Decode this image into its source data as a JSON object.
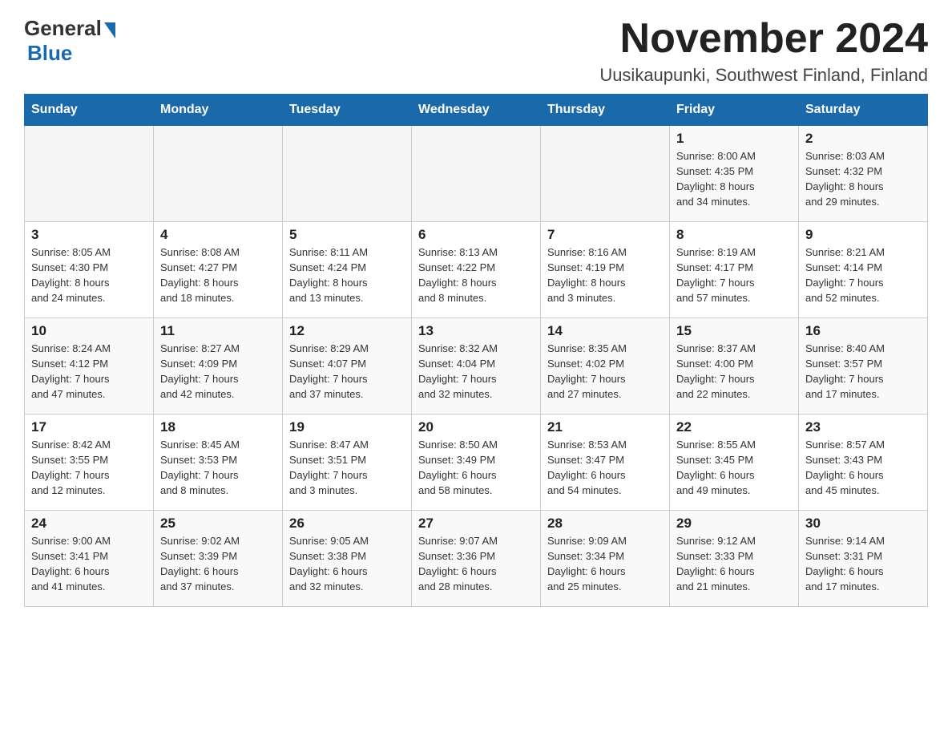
{
  "header": {
    "logo_general": "General",
    "logo_blue": "Blue",
    "month_title": "November 2024",
    "location": "Uusikaupunki, Southwest Finland, Finland"
  },
  "weekdays": [
    "Sunday",
    "Monday",
    "Tuesday",
    "Wednesday",
    "Thursday",
    "Friday",
    "Saturday"
  ],
  "weeks": [
    [
      {
        "day": "",
        "info": ""
      },
      {
        "day": "",
        "info": ""
      },
      {
        "day": "",
        "info": ""
      },
      {
        "day": "",
        "info": ""
      },
      {
        "day": "",
        "info": ""
      },
      {
        "day": "1",
        "info": "Sunrise: 8:00 AM\nSunset: 4:35 PM\nDaylight: 8 hours\nand 34 minutes."
      },
      {
        "day": "2",
        "info": "Sunrise: 8:03 AM\nSunset: 4:32 PM\nDaylight: 8 hours\nand 29 minutes."
      }
    ],
    [
      {
        "day": "3",
        "info": "Sunrise: 8:05 AM\nSunset: 4:30 PM\nDaylight: 8 hours\nand 24 minutes."
      },
      {
        "day": "4",
        "info": "Sunrise: 8:08 AM\nSunset: 4:27 PM\nDaylight: 8 hours\nand 18 minutes."
      },
      {
        "day": "5",
        "info": "Sunrise: 8:11 AM\nSunset: 4:24 PM\nDaylight: 8 hours\nand 13 minutes."
      },
      {
        "day": "6",
        "info": "Sunrise: 8:13 AM\nSunset: 4:22 PM\nDaylight: 8 hours\nand 8 minutes."
      },
      {
        "day": "7",
        "info": "Sunrise: 8:16 AM\nSunset: 4:19 PM\nDaylight: 8 hours\nand 3 minutes."
      },
      {
        "day": "8",
        "info": "Sunrise: 8:19 AM\nSunset: 4:17 PM\nDaylight: 7 hours\nand 57 minutes."
      },
      {
        "day": "9",
        "info": "Sunrise: 8:21 AM\nSunset: 4:14 PM\nDaylight: 7 hours\nand 52 minutes."
      }
    ],
    [
      {
        "day": "10",
        "info": "Sunrise: 8:24 AM\nSunset: 4:12 PM\nDaylight: 7 hours\nand 47 minutes."
      },
      {
        "day": "11",
        "info": "Sunrise: 8:27 AM\nSunset: 4:09 PM\nDaylight: 7 hours\nand 42 minutes."
      },
      {
        "day": "12",
        "info": "Sunrise: 8:29 AM\nSunset: 4:07 PM\nDaylight: 7 hours\nand 37 minutes."
      },
      {
        "day": "13",
        "info": "Sunrise: 8:32 AM\nSunset: 4:04 PM\nDaylight: 7 hours\nand 32 minutes."
      },
      {
        "day": "14",
        "info": "Sunrise: 8:35 AM\nSunset: 4:02 PM\nDaylight: 7 hours\nand 27 minutes."
      },
      {
        "day": "15",
        "info": "Sunrise: 8:37 AM\nSunset: 4:00 PM\nDaylight: 7 hours\nand 22 minutes."
      },
      {
        "day": "16",
        "info": "Sunrise: 8:40 AM\nSunset: 3:57 PM\nDaylight: 7 hours\nand 17 minutes."
      }
    ],
    [
      {
        "day": "17",
        "info": "Sunrise: 8:42 AM\nSunset: 3:55 PM\nDaylight: 7 hours\nand 12 minutes."
      },
      {
        "day": "18",
        "info": "Sunrise: 8:45 AM\nSunset: 3:53 PM\nDaylight: 7 hours\nand 8 minutes."
      },
      {
        "day": "19",
        "info": "Sunrise: 8:47 AM\nSunset: 3:51 PM\nDaylight: 7 hours\nand 3 minutes."
      },
      {
        "day": "20",
        "info": "Sunrise: 8:50 AM\nSunset: 3:49 PM\nDaylight: 6 hours\nand 58 minutes."
      },
      {
        "day": "21",
        "info": "Sunrise: 8:53 AM\nSunset: 3:47 PM\nDaylight: 6 hours\nand 54 minutes."
      },
      {
        "day": "22",
        "info": "Sunrise: 8:55 AM\nSunset: 3:45 PM\nDaylight: 6 hours\nand 49 minutes."
      },
      {
        "day": "23",
        "info": "Sunrise: 8:57 AM\nSunset: 3:43 PM\nDaylight: 6 hours\nand 45 minutes."
      }
    ],
    [
      {
        "day": "24",
        "info": "Sunrise: 9:00 AM\nSunset: 3:41 PM\nDaylight: 6 hours\nand 41 minutes."
      },
      {
        "day": "25",
        "info": "Sunrise: 9:02 AM\nSunset: 3:39 PM\nDaylight: 6 hours\nand 37 minutes."
      },
      {
        "day": "26",
        "info": "Sunrise: 9:05 AM\nSunset: 3:38 PM\nDaylight: 6 hours\nand 32 minutes."
      },
      {
        "day": "27",
        "info": "Sunrise: 9:07 AM\nSunset: 3:36 PM\nDaylight: 6 hours\nand 28 minutes."
      },
      {
        "day": "28",
        "info": "Sunrise: 9:09 AM\nSunset: 3:34 PM\nDaylight: 6 hours\nand 25 minutes."
      },
      {
        "day": "29",
        "info": "Sunrise: 9:12 AM\nSunset: 3:33 PM\nDaylight: 6 hours\nand 21 minutes."
      },
      {
        "day": "30",
        "info": "Sunrise: 9:14 AM\nSunset: 3:31 PM\nDaylight: 6 hours\nand 17 minutes."
      }
    ]
  ]
}
